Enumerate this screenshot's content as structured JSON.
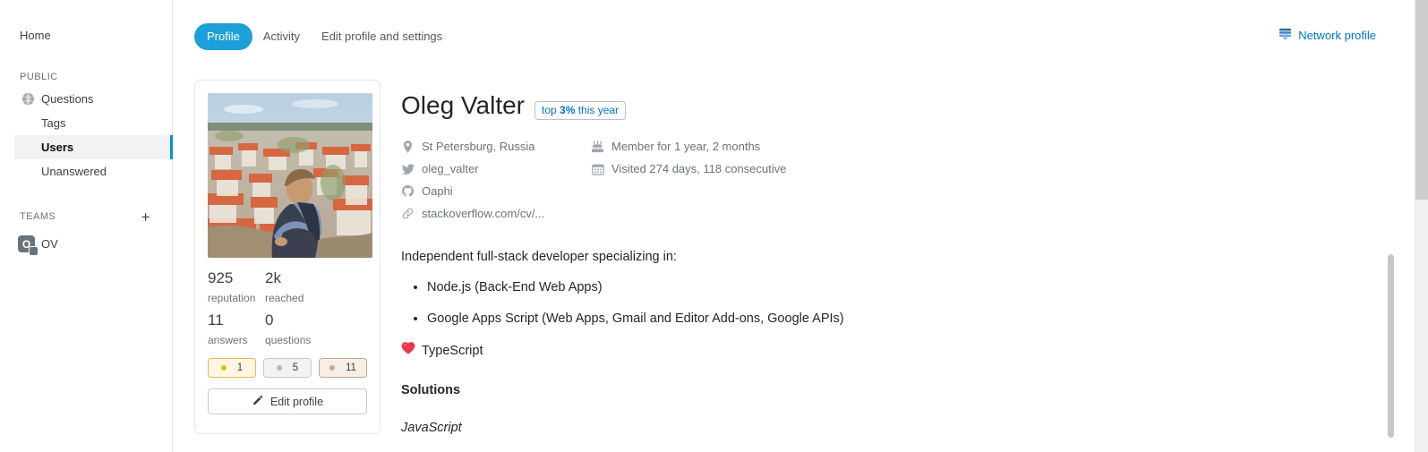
{
  "sidebar": {
    "home_label": "Home",
    "public_label": "PUBLIC",
    "items": [
      {
        "label": "Questions",
        "icon": "globe-icon"
      },
      {
        "label": "Tags",
        "icon": ""
      },
      {
        "label": "Users",
        "icon": ""
      },
      {
        "label": "Unanswered",
        "icon": ""
      }
    ],
    "teams_label": "TEAMS",
    "add_team_label": "+",
    "team": {
      "label": "OV",
      "avatar_letter": "O"
    }
  },
  "tabs": {
    "profile": "Profile",
    "activity": "Activity",
    "edit": "Edit profile and settings"
  },
  "network": {
    "label": "Network profile"
  },
  "card": {
    "stats": [
      {
        "value": "925",
        "label": "reputation"
      },
      {
        "value": "2k",
        "label": "reached"
      },
      {
        "value": "11",
        "label": "answers"
      },
      {
        "value": "0",
        "label": "questions"
      }
    ],
    "badges": [
      {
        "tier": "gold",
        "count": "1"
      },
      {
        "tier": "silver",
        "count": "5"
      },
      {
        "tier": "bronze",
        "count": "11"
      }
    ],
    "edit_profile_label": "Edit profile"
  },
  "profile": {
    "name": "Oleg Valter",
    "top_badge_prefix": "top ",
    "top_badge_strong": "3%",
    "top_badge_suffix": " this year",
    "meta_left": [
      {
        "icon": "location-pin-icon",
        "text": "St Petersburg, Russia"
      },
      {
        "icon": "twitter-icon",
        "text": "oleg_valter"
      },
      {
        "icon": "github-icon",
        "text": "Oaphi"
      },
      {
        "icon": "link-icon",
        "text": "stackoverflow.com/cv/..."
      }
    ],
    "meta_right": [
      {
        "icon": "cake-icon",
        "text": "Member for 1 year, 2 months"
      },
      {
        "icon": "calendar-icon",
        "text": "Visited 274 days, 118 consecutive"
      }
    ],
    "bio_intro": "Independent full-stack developer specializing in:",
    "bio_list": [
      "Node.js (Back-End Web Apps)",
      "Google Apps Script (Web Apps, Gmail and Editor Add-ons, Google APIs)"
    ],
    "heart_text": "TypeScript",
    "solutions_heading": "Solutions",
    "solutions_sub": "JavaScript"
  },
  "colors": {
    "accent_blue": "#1ca0d8",
    "link_blue": "#0074cc",
    "selected_bar": "#0095cd",
    "text": "#232629",
    "muted": "#6a737c"
  }
}
